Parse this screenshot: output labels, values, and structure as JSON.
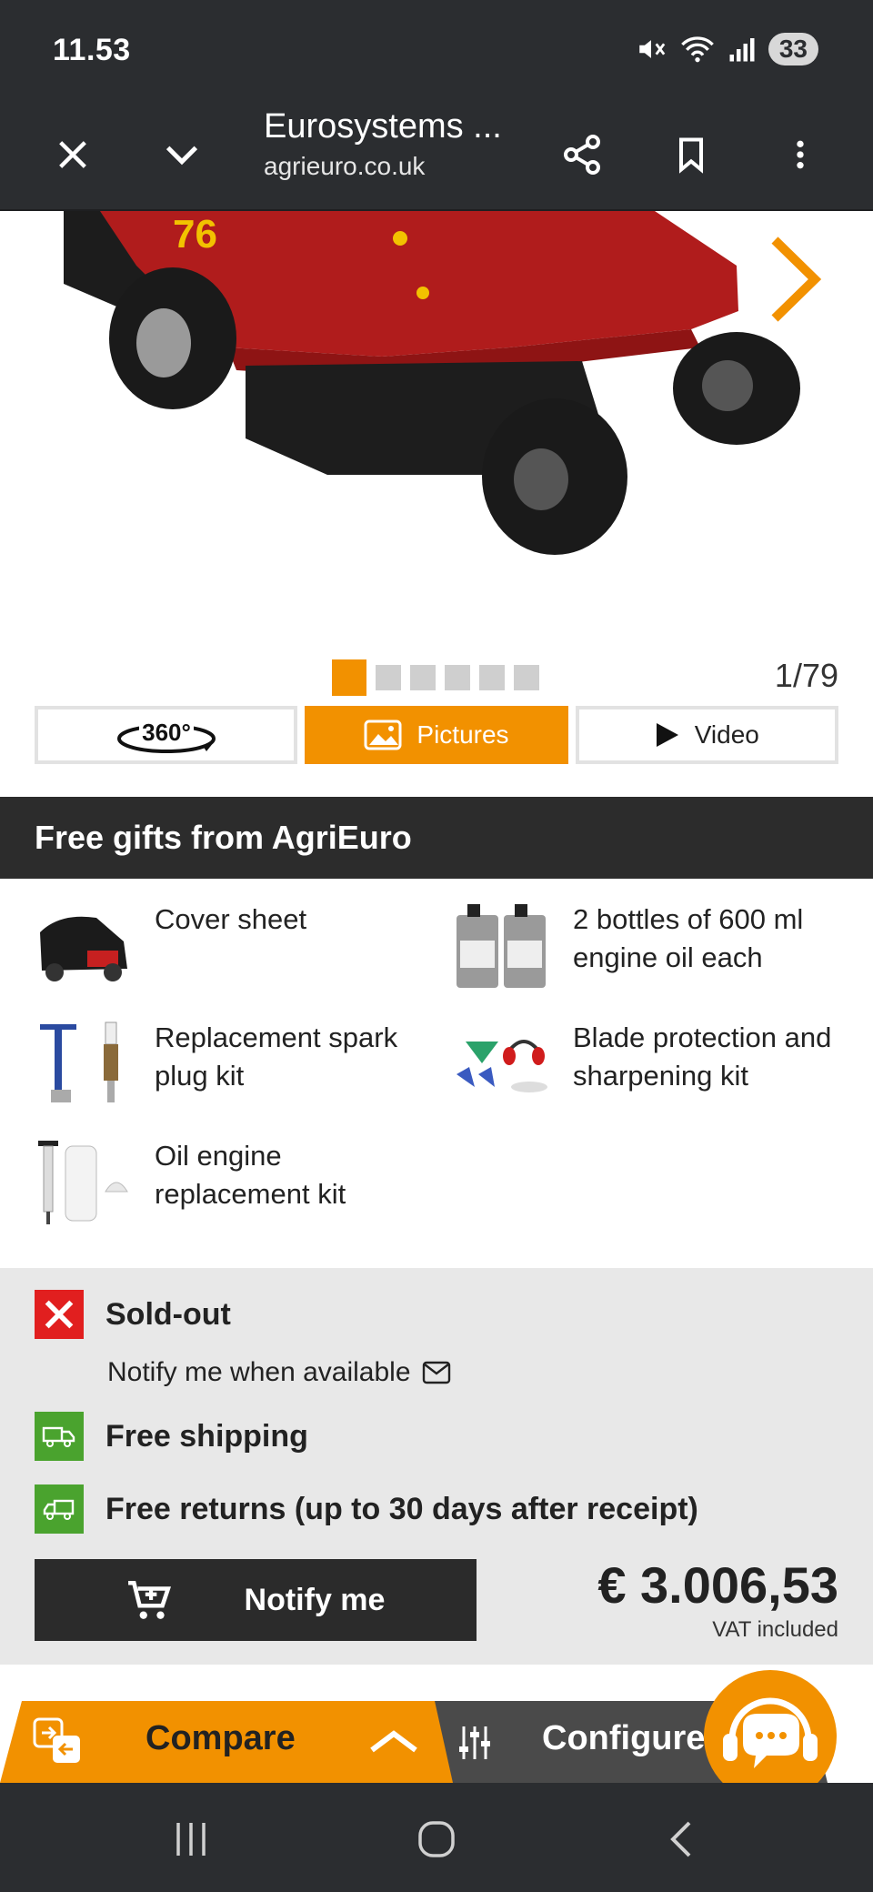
{
  "status_bar": {
    "time": "11.53",
    "battery": "33"
  },
  "browser": {
    "title": "Eurosystems ...",
    "url": "agrieuro.co.uk"
  },
  "gallery": {
    "counter": "1/79",
    "tabs": [
      {
        "label": "360°"
      },
      {
        "label": "Pictures"
      },
      {
        "label": "Video"
      }
    ]
  },
  "gifts": {
    "heading": "Free gifts from AgriEuro",
    "items": [
      {
        "label": "Cover sheet"
      },
      {
        "label": "2 bottles of 600 ml engine oil each"
      },
      {
        "label": "Replacement spark plug kit"
      },
      {
        "label": "Blade protection and sharpening kit"
      },
      {
        "label": "Oil engine replacement kit"
      }
    ]
  },
  "availability": {
    "status": "Sold-out",
    "notify_link": "Notify me when available",
    "shipping": "Free shipping",
    "returns": "Free returns (up to 30 days after receipt)",
    "notify_button": "Notify me",
    "price": "€ 3.006,53",
    "vat": "VAT included"
  },
  "bottom_bar": {
    "compare": "Compare",
    "configure": "Configure"
  },
  "colors": {
    "accent": "#f29100",
    "dark": "#2b2d30",
    "sold_out": "#e11f1f",
    "success": "#4aa32e"
  }
}
